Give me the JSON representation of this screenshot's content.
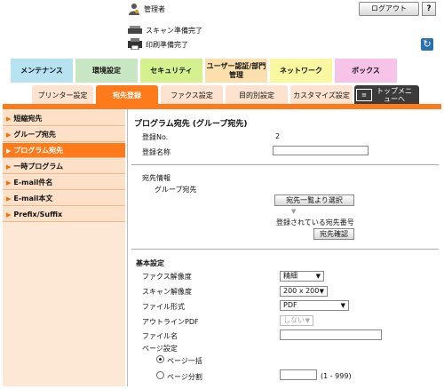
{
  "header": {
    "user_label": "管理者",
    "logout_label": "ログアウト",
    "help_label": "?",
    "status": [
      "スキャン準備完了",
      "印刷準備完了"
    ]
  },
  "main_tabs": [
    "メンテナンス",
    "環境設定",
    "セキュリティ",
    "ユーザー認証/部門管理",
    "ネットワーク",
    "ボックス"
  ],
  "sub_tabs": [
    "プリンター設定",
    "宛先登録",
    "ファクス設定",
    "目的別設定",
    "カスタマイズ設定",
    "トップメニューへ"
  ],
  "sidebar": [
    "短縮宛先",
    "グループ宛先",
    "プログラム宛先",
    "一時プログラム",
    "E-mail件名",
    "E-mail本文",
    "Prefix/Suffix"
  ],
  "form": {
    "title": "プログラム宛先 (グループ宛先)",
    "reg_no_label": "登録No.",
    "reg_no_value": "2",
    "reg_name_label": "登録名称",
    "reg_name_value": "",
    "dest_info_label": "宛先情報",
    "group_dest_label": "グループ宛先",
    "select_from_list": "宛先一覧より選択",
    "registered_label": "登録されている宛先番号",
    "confirm_button": "宛先確認",
    "basic_title": "基本設定",
    "fax_res_label": "ファクス解像度",
    "fax_res_value": "精細",
    "scan_res_label": "スキャン解像度",
    "scan_res_value": "200 x 200",
    "file_format_label": "ファイル形式",
    "file_format_value": "PDF",
    "outline_label": "アウトラインPDF",
    "outline_value": "しない",
    "file_name_label": "ファイル名",
    "file_name_value": "",
    "page_setting_label": "ページ設定",
    "radio_all": "ページ一括",
    "radio_split": "ページ分割",
    "split_range": "(1 - 999)"
  },
  "colors": {
    "accent_orange": "#ff7a1a",
    "sidebar_bg": "#fde0c8"
  }
}
